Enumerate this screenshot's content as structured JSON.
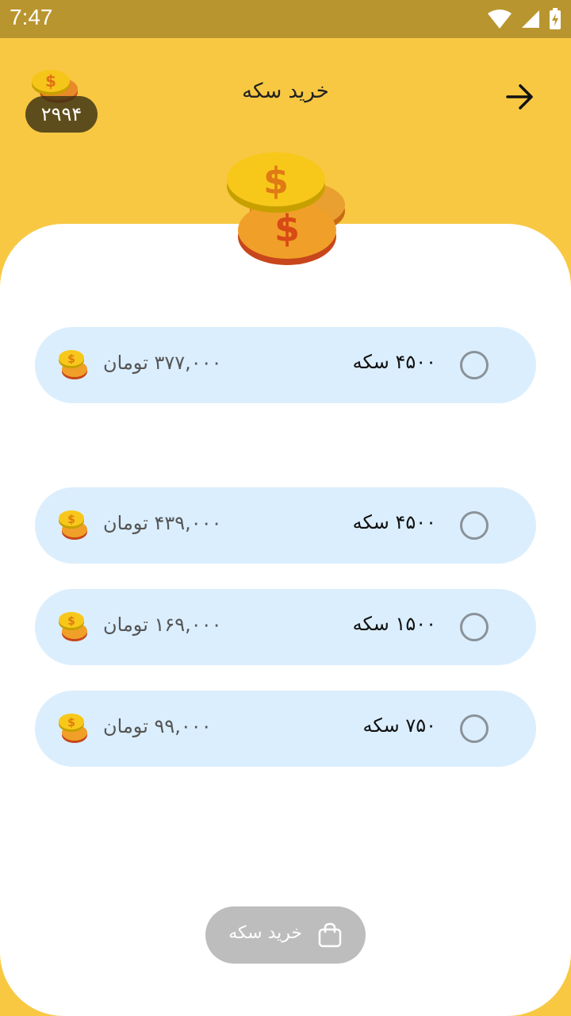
{
  "status": {
    "time": "7:47"
  },
  "header": {
    "title": "خرید سکه",
    "balance": "۲۹۹۴"
  },
  "options": [
    {
      "coins": "۴۵۰۰ سکه",
      "price": "۳۷۷,۰۰۰ تومان"
    },
    {
      "coins": "۴۵۰۰ سکه",
      "price": "۴۳۹,۰۰۰ تومان"
    },
    {
      "coins": "۱۵۰۰ سکه",
      "price": "۱۶۹,۰۰۰ تومان"
    },
    {
      "coins": "۷۵۰ سکه",
      "price": "۹۹,۰۰۰ تومان"
    }
  ],
  "buy_button": {
    "label": "خرید سکه"
  },
  "colors": {
    "header_bg": "#F8C843",
    "status_bar": "#B9952F",
    "option_bg": "#DBEEFD",
    "button_disabled": "#BDBDBD"
  },
  "icons": [
    "wifi-icon",
    "signal-icon",
    "battery-icon",
    "arrow-right-icon",
    "coin-stack-icon",
    "shopping-bag-icon",
    "radio-unchecked-icon"
  ]
}
